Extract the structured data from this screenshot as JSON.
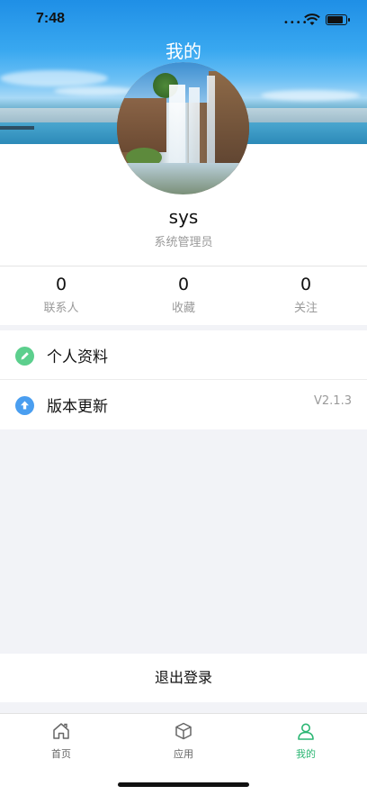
{
  "status_bar": {
    "time": "7:48"
  },
  "header": {
    "title": "我的"
  },
  "profile": {
    "username": "sys",
    "role": "系统管理员"
  },
  "stats": [
    {
      "value": "0",
      "label": "联系人"
    },
    {
      "value": "0",
      "label": "收藏"
    },
    {
      "value": "0",
      "label": "关注"
    }
  ],
  "menu": [
    {
      "label": "个人资料",
      "icon": "edit-icon",
      "color": "#5ccf8d",
      "value": ""
    },
    {
      "label": "版本更新",
      "icon": "upload-icon",
      "color": "#4a9ef0",
      "value": "V2.1.3"
    }
  ],
  "logout": {
    "label": "退出登录"
  },
  "tabbar": {
    "items": [
      {
        "label": "首页",
        "icon": "home-icon"
      },
      {
        "label": "应用",
        "icon": "box-icon"
      },
      {
        "label": "我的",
        "icon": "user-icon",
        "active": true
      }
    ],
    "active_color": "#2bb673"
  }
}
